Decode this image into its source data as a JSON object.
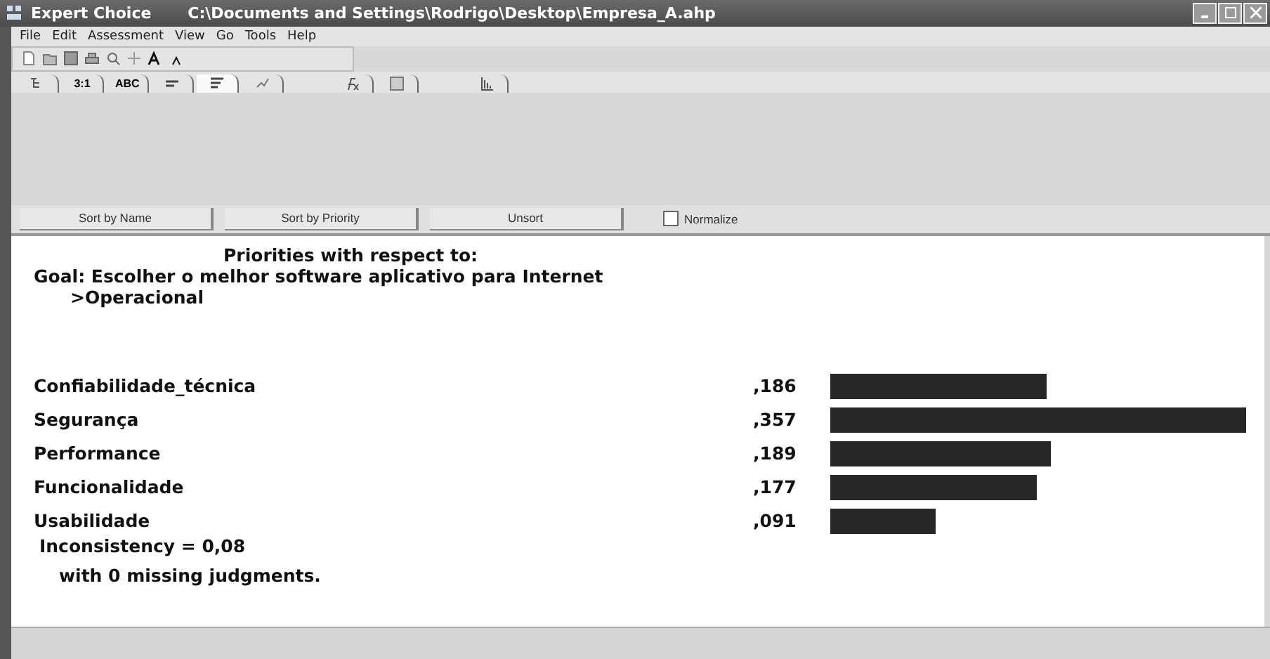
{
  "window": {
    "app": "Expert Choice",
    "path": "C:\\Documents and Settings\\Rodrigo\\Desktop\\Empresa_A.ahp"
  },
  "menu": [
    "File",
    "Edit",
    "Assessment",
    "View",
    "Go",
    "Tools",
    "Help"
  ],
  "tabs": [
    {
      "kind": "icon",
      "selected": false
    },
    {
      "kind": "text",
      "label": "3:1",
      "selected": false
    },
    {
      "kind": "text",
      "label": "ABC",
      "selected": false
    },
    {
      "kind": "icon",
      "selected": false
    },
    {
      "kind": "icon",
      "selected": true
    },
    {
      "kind": "icon",
      "selected": false
    },
    {
      "kind": "gap"
    },
    {
      "kind": "icon",
      "selected": false
    },
    {
      "kind": "icon",
      "selected": false
    },
    {
      "kind": "gap"
    },
    {
      "kind": "icon",
      "selected": false
    }
  ],
  "buttons": [
    "Sort by Name",
    "Sort by Priority",
    "Unsort"
  ],
  "normalize": {
    "label": "Normalize",
    "checked": false
  },
  "report": {
    "heading": "Priorities with respect to:",
    "goal": "Goal: Escolher o melhor software aplicativo para Internet",
    "node": ">Operacional",
    "items": [
      {
        "name": "Confiabilidade_técnica",
        "value": ",186"
      },
      {
        "name": "Segurança",
        "value": ",357"
      },
      {
        "name": "Performance",
        "value": ",189"
      },
      {
        "name": "Funcionalidade",
        "value": ",177"
      },
      {
        "name": "Usabilidade",
        "value": ",091"
      }
    ],
    "inconsistency": "Inconsistency = 0,08",
    "missing": "with 0  missing judgments."
  }
}
